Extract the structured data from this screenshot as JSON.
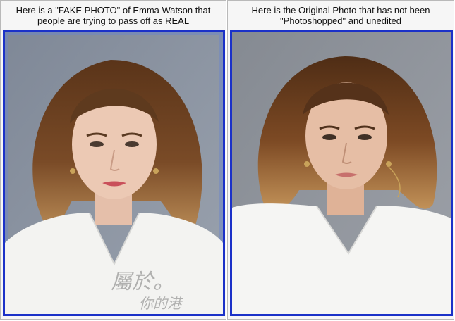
{
  "panels": [
    {
      "caption": "Here is a \"FAKE PHOTO\" of Emma Watson that people are trying to pass off as REAL",
      "image_alt": "edited portrait of a woman with shoulder-length wavy brown hair, white top, grey background, with a faint watermark"
    },
    {
      "caption": "Here is the Original Photo that has not been \"Photoshopped\" and unedited",
      "image_alt": "original portrait of a woman with shoulder-length wavy brown hair, white top, grey background"
    }
  ],
  "colors": {
    "frame": "#1b31c8",
    "background_left": "#8c94a2",
    "background_right": "#8e9299",
    "hair": "#6b4022",
    "skin": "#e9c6b1",
    "top": "#f4f4f2"
  }
}
